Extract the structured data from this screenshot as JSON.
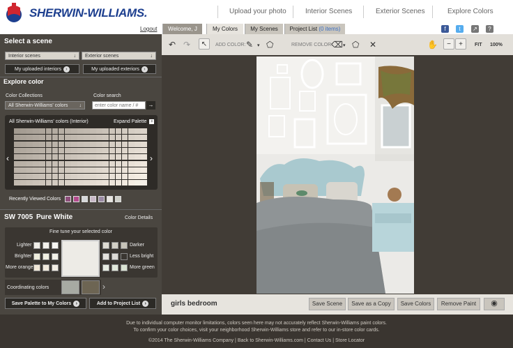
{
  "header": {
    "brand": "SHERWIN-WILLIAMS.",
    "nav": [
      "Upload your photo",
      "Interior Scenes",
      "Exterior Scenes",
      "Explore Colors"
    ],
    "logout": "Logout"
  },
  "tabs": {
    "welcome": "Welcome, J",
    "my_colors": "My Colors",
    "my_scenes": "My Scenes",
    "project_list": "Project List",
    "project_count": "(0 items)"
  },
  "left": {
    "select_scene_title": "Select a scene",
    "interior_select": "Interior scenes",
    "exterior_select": "Exterior scenes",
    "my_uploaded_interiors": "My uploaded interiors",
    "my_uploaded_exteriors": "My uploaded exteriors",
    "explore_title": "Explore color",
    "collections_label": "Color Collections",
    "collections_value": "All Sherwin-Williams' colors",
    "search_label": "Color search",
    "search_placeholder": "enter color name / #",
    "palette_title": "All Sherwin-Williams' colors (Interior)",
    "expand_palette": "Expand Palette",
    "recently_viewed_label": "Recently Viewed Colors",
    "recent_colors": [
      "#8d4e7a",
      "#b24a8c",
      "#d6d8da",
      "#c9b9c8",
      "#9a8aa4",
      "#e8e6e1",
      "#cfd0c9"
    ],
    "color_code": "SW 7005",
    "color_name": "Pure White",
    "color_details": "Color Details",
    "fine_tune_title": "Fine tune your selected color",
    "fine_tune_labels": [
      "Lighter",
      "Brighter",
      "More orange",
      "Darker",
      "Less bright",
      "More green"
    ],
    "selected_color_hex": "#edebe6",
    "coordinating_label": "Coordinating colors",
    "coordinating_colors": [
      "#a7aaa3",
      "#6d6553"
    ],
    "save_palette": "Save Palette to My Colors",
    "add_to_project": "Add to Project List"
  },
  "toolbar": {
    "add_color_label": "ADD COLOR:",
    "remove_color_label": "REMOVE COLOR:",
    "fit_label": "FIT",
    "zoom_label": "100%"
  },
  "scene": {
    "title": "girls bedroom"
  },
  "actions": {
    "save_scene": "Save Scene",
    "save_copy": "Save as a Copy",
    "save_colors": "Save Colors",
    "remove_paint": "Remove Paint"
  },
  "footer": {
    "disclaimer_1": "Due to individual computer monitor limitations, colors seen here may not accurately reflect Sherwin-Williams paint colors.",
    "disclaimer_2": "To confirm your color choices, visit your neighborhood Sherwin-Williams store and refer to our in-store color cards.",
    "copyright": "©2014 The Sherwin-Williams Company",
    "back_link": "Back to Sherwin-Williams.com",
    "contact_link": "Contact Us",
    "store_link": "Store Locator"
  },
  "colors": {
    "brand_blue": "#1d3f8f",
    "brand_red": "#d0262f",
    "panel_dark": "#4a4640"
  }
}
